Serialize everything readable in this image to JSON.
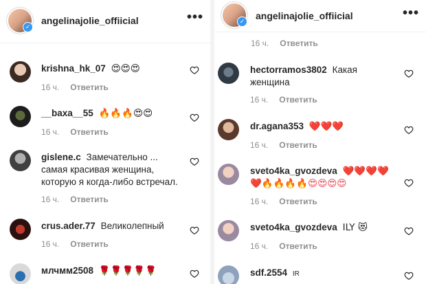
{
  "left": {
    "username": "angelinajolie_offiicial",
    "more_label": "•••",
    "comments": [
      {
        "user": "krishna_hk_07",
        "text": "😍😍😍",
        "time": "16 ч.",
        "reply": "Ответить"
      },
      {
        "user": "__baxa__55",
        "text": "🔥🔥🔥😍😍",
        "time": "16 ч.",
        "reply": "Ответить"
      },
      {
        "user": "gislene.c",
        "text": "Замечательно ... самая красивая женщина, которую я когда-либо встречал.",
        "time": "16 ч.",
        "reply": "Ответить"
      },
      {
        "user": "crus.ader.77",
        "text": "Великолепный",
        "time": "16 ч.",
        "reply": "Ответить"
      },
      {
        "user": "млчмм2508",
        "text": "🌹🌹🌹🌹🌹",
        "time": "",
        "reply": ""
      }
    ]
  },
  "right": {
    "username": "angelinajolie_offiicial",
    "more_label": "•••",
    "top_meta": {
      "time": "16 ч.",
      "reply": "Ответить"
    },
    "comments": [
      {
        "user": "hectorramos3802",
        "text": "Какая женщина",
        "time": "16 ч.",
        "reply": "Ответить"
      },
      {
        "user": "dr.agana353",
        "text": "❤️❤️❤️",
        "time": "16 ч.",
        "reply": "Ответить"
      },
      {
        "user": "sveto4ka_gvozdeva",
        "text": "❤️❤️❤️❤️❤️🔥🔥🔥🔥😍😍😍😍",
        "time": "16 ч.",
        "reply": "Ответить"
      },
      {
        "user": "sveto4ka_gvozdeva",
        "text": "ILY 😻",
        "time": "16 ч.",
        "reply": "Ответить"
      },
      {
        "user": "sdf.2554",
        "text": "IR",
        "time": "",
        "reply": ""
      }
    ]
  },
  "colors": {
    "text": "#262626",
    "muted": "#8e8e8e",
    "verified": "#3897f0",
    "divider": "#efefef"
  },
  "icons": {
    "like": "heart-outline-icon",
    "verified": "verified-badge-icon",
    "more": "more-horizontal-icon"
  }
}
